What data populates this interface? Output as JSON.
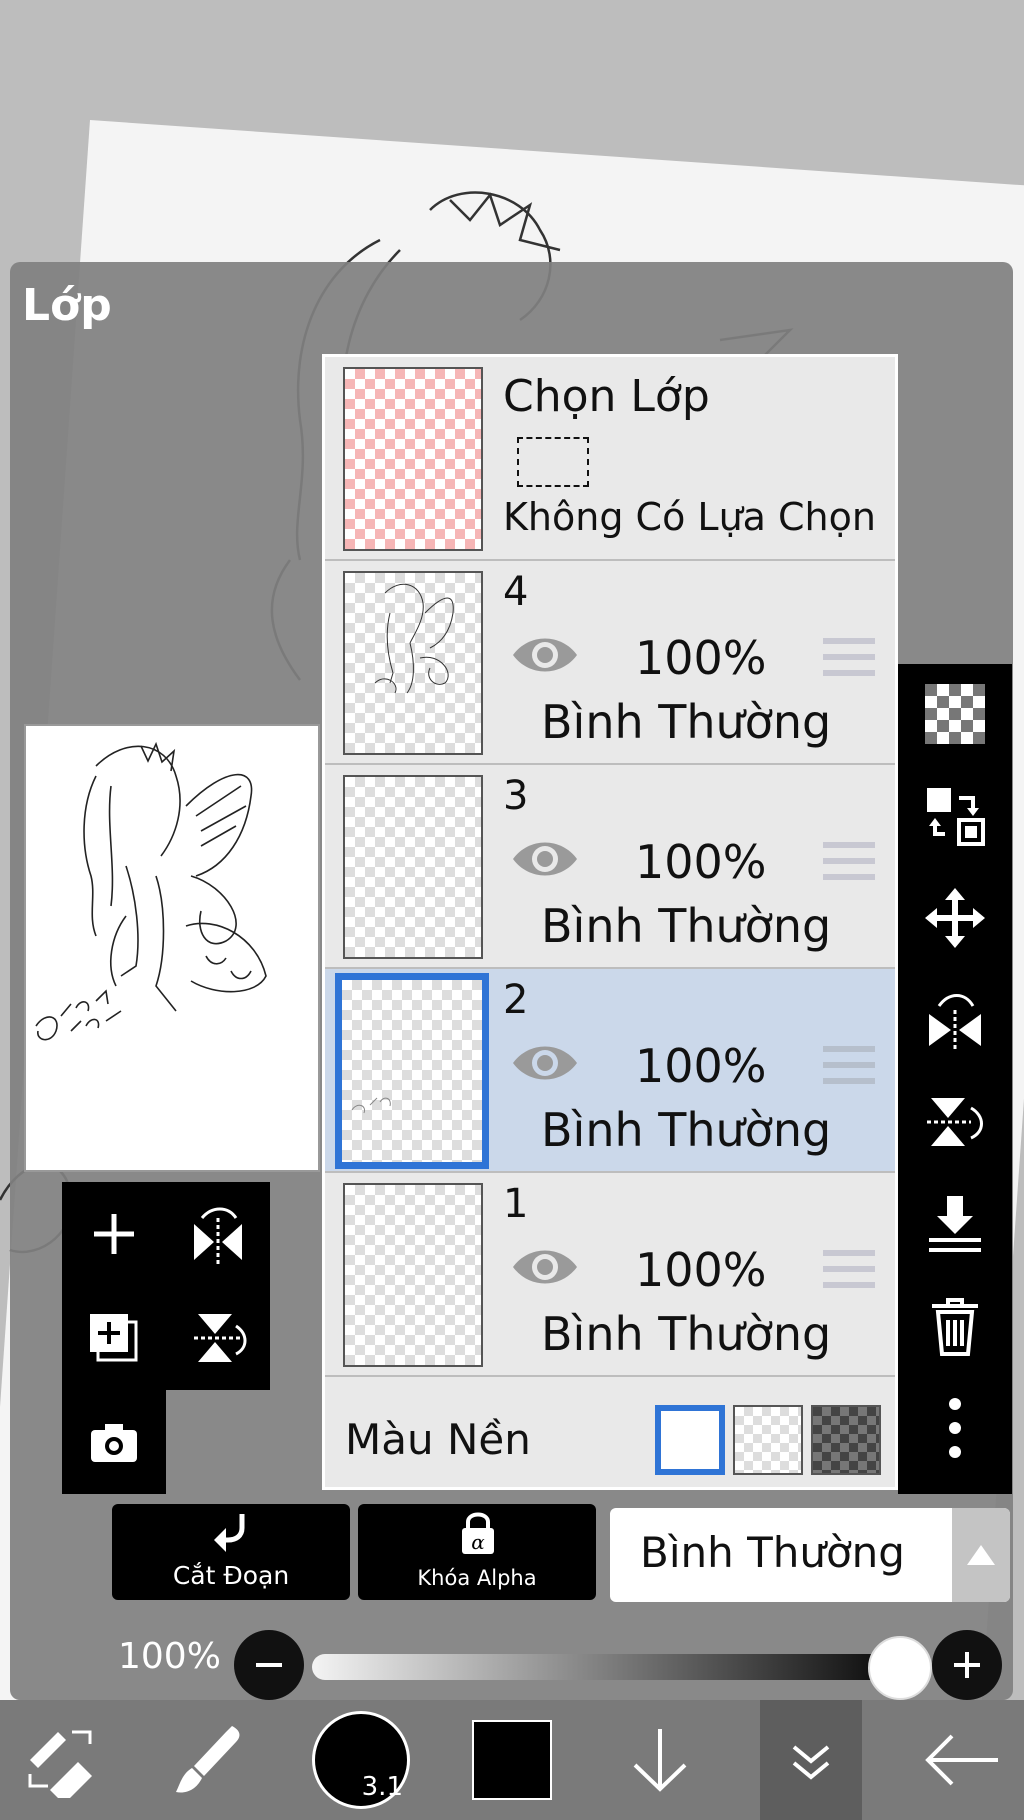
{
  "panel": {
    "title": "Lớp"
  },
  "selection_layer": {
    "title": "Chọn Lớp",
    "status": "Không Có Lựa Chọn"
  },
  "layers": [
    {
      "number": "4",
      "opacity": "100%",
      "blend": "Bình Thường",
      "visible": true,
      "selected": false
    },
    {
      "number": "3",
      "opacity": "100%",
      "blend": "Bình Thường",
      "visible": true,
      "selected": false
    },
    {
      "number": "2",
      "opacity": "100%",
      "blend": "Bình Thường",
      "visible": true,
      "selected": true
    },
    {
      "number": "1",
      "opacity": "100%",
      "blend": "Bình Thường",
      "visible": true,
      "selected": false
    }
  ],
  "background": {
    "label": "Màu Nền",
    "options": [
      "white",
      "checker-light",
      "checker-dark"
    ],
    "selected": "white"
  },
  "preview": {
    "signature": "@hoang hom"
  },
  "left_tools": [
    "add-layer-icon",
    "flip-horizontal-icon",
    "duplicate-layer-icon",
    "flip-vertical-icon",
    "camera-icon"
  ],
  "right_tools": [
    "transparency-icon",
    "swap-layers-icon",
    "move-icon",
    "flip-horizontal-icon",
    "flip-vertical-icon",
    "merge-down-icon",
    "delete-icon",
    "more-icon"
  ],
  "actions": {
    "clip_label": "Cắt Đoạn",
    "alpha_label": "Khóa Alpha",
    "blend_mode": "Bình Thường"
  },
  "opacity": {
    "label": "100%",
    "value": 1.0
  },
  "bottom_bar": {
    "brush_size": "3.1",
    "color": "#000000"
  },
  "colors": {
    "accent": "#2f74d6",
    "selected_row": "#cbd8ea",
    "panel": "#808080"
  }
}
